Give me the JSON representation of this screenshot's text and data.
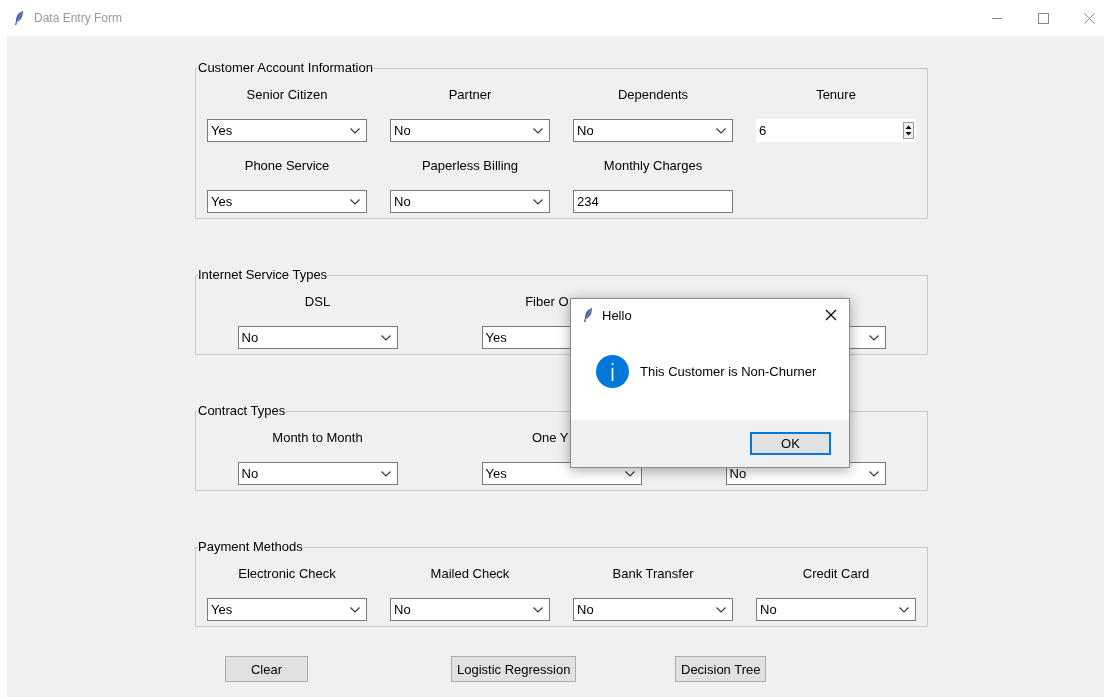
{
  "window": {
    "title": "Data Entry Form"
  },
  "groups": [
    {
      "title": "Customer Account Information",
      "rows": [
        [
          {
            "label": "Senior Citizen",
            "kind": "dropdown",
            "value": "Yes"
          },
          {
            "label": "Partner",
            "kind": "dropdown",
            "value": "No"
          },
          {
            "label": "Dependents",
            "kind": "dropdown",
            "value": "No"
          },
          {
            "label": "Tenure",
            "kind": "spinbox",
            "value": "6"
          }
        ],
        [
          {
            "label": "Phone Service",
            "kind": "dropdown",
            "value": "Yes"
          },
          {
            "label": "Paperless Billing",
            "kind": "dropdown",
            "value": "No"
          },
          {
            "label": "Monthly Charges",
            "kind": "entry",
            "value": "234"
          }
        ]
      ]
    },
    {
      "title": "Internet Service Types",
      "rows": [
        [
          {
            "label": "DSL",
            "kind": "dropdown",
            "value": "No"
          },
          {
            "label": "Fiber O",
            "truncated": true,
            "kind": "covered-dropdown",
            "value": "Yes"
          },
          {
            "kind": "dropdown"
          }
        ]
      ]
    },
    {
      "title": "Contract Types",
      "rows": [
        [
          {
            "label": "Month to Month",
            "kind": "dropdown",
            "value": "No"
          },
          {
            "label": "One Y",
            "truncated": true,
            "kind": "dropdown",
            "value": "Yes"
          },
          {
            "kind": "dropdown",
            "value": "No"
          }
        ]
      ]
    },
    {
      "title": "Payment Methods",
      "rows": [
        [
          {
            "label": "Electronic Check",
            "kind": "dropdown",
            "value": "Yes"
          },
          {
            "label": "Mailed Check",
            "kind": "dropdown",
            "value": "No"
          },
          {
            "label": "Bank Transfer",
            "kind": "dropdown",
            "value": "No"
          },
          {
            "label": "Credit Card",
            "kind": "dropdown",
            "value": "No"
          }
        ]
      ]
    }
  ],
  "buttons": [
    "Clear",
    "Logistic Regression",
    "Decision Tree"
  ],
  "dialog": {
    "title": "Hello",
    "message": "This Customer is Non-Churner",
    "buttons": [
      {
        "label": "OK",
        "focused": true
      }
    ]
  }
}
